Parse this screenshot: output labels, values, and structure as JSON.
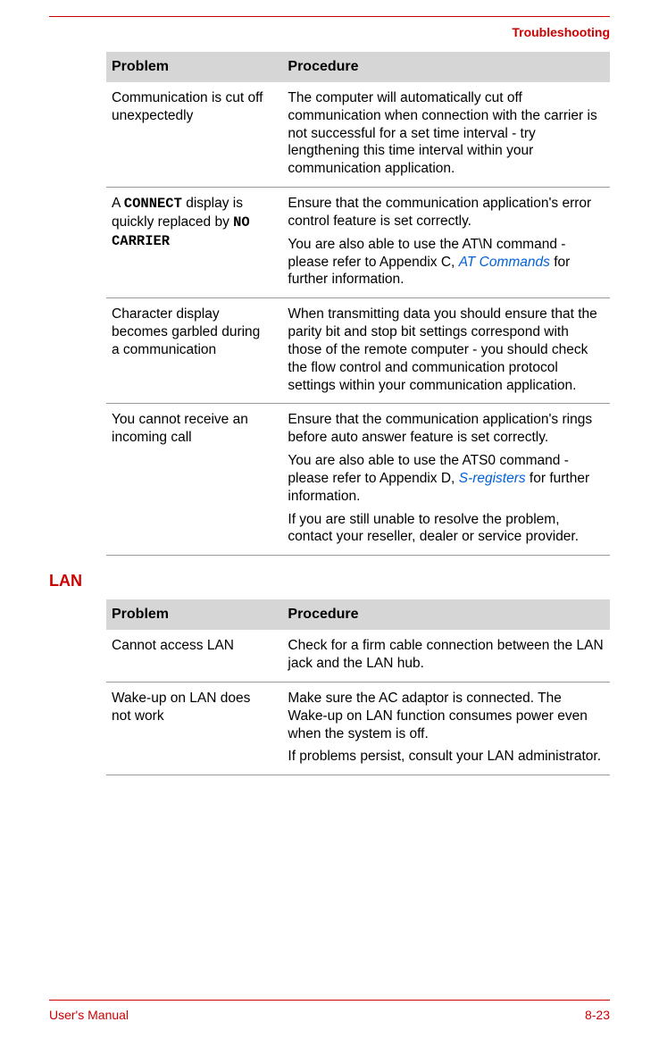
{
  "header": {
    "section": "Troubleshooting"
  },
  "table1": {
    "head": {
      "problem": "Problem",
      "procedure": "Procedure"
    },
    "rows": [
      {
        "problem_parts": [
          {
            "text": "Communication is cut off unexpectedly"
          }
        ],
        "procedure_parts": [
          {
            "paras": [
              [
                {
                  "text": "The computer will automatically cut off communication when connection with the carrier is not successful for a set time interval - try lengthening this time interval within your communication application."
                }
              ]
            ]
          }
        ]
      },
      {
        "problem_parts": [
          {
            "text": "A "
          },
          {
            "text": "CONNECT",
            "mono": true
          },
          {
            "text": " display is quickly replaced by "
          },
          {
            "text": "NO CARRIER",
            "mono": true
          }
        ],
        "procedure_parts": [
          {
            "paras": [
              [
                {
                  "text": "Ensure that the communication application's error control feature is set correctly."
                }
              ],
              [
                {
                  "text": "You are also able to use the AT\\N command - please refer to Appendix C, "
                },
                {
                  "text": "AT Commands",
                  "link": true
                },
                {
                  "text": " for further information."
                }
              ]
            ]
          }
        ]
      },
      {
        "problem_parts": [
          {
            "text": "Character display becomes garbled during a communication"
          }
        ],
        "procedure_parts": [
          {
            "paras": [
              [
                {
                  "text": "When transmitting data you should ensure that the parity bit and stop bit settings correspond with those of the remote computer - you should check the flow control and communication protocol settings within your communication application."
                }
              ]
            ]
          }
        ]
      },
      {
        "problem_parts": [
          {
            "text": "You cannot receive an incoming call"
          }
        ],
        "procedure_parts": [
          {
            "paras": [
              [
                {
                  "text": "Ensure that the communication application's rings before auto answer feature is set correctly."
                }
              ],
              [
                {
                  "text": "You are also able to use the ATS0 command - please refer to Appendix D, "
                },
                {
                  "text": "S-registers",
                  "link": true
                },
                {
                  "text": " for further information."
                }
              ],
              [
                {
                  "text": "If you are still unable to resolve the problem, contact your reseller, dealer or service provider."
                }
              ]
            ]
          }
        ]
      }
    ]
  },
  "section_lan": "LAN",
  "table2": {
    "head": {
      "problem": "Problem",
      "procedure": "Procedure"
    },
    "rows": [
      {
        "problem_parts": [
          {
            "text": "Cannot access LAN"
          }
        ],
        "procedure_parts": [
          {
            "paras": [
              [
                {
                  "text": "Check for a firm cable connection between the LAN jack and the LAN hub."
                }
              ]
            ]
          }
        ]
      },
      {
        "problem_parts": [
          {
            "text": "Wake-up on LAN does not work"
          }
        ],
        "procedure_parts": [
          {
            "paras": [
              [
                {
                  "text": "Make sure the AC adaptor is connected. The Wake-up on LAN function consumes power even when the system is off."
                }
              ],
              [
                {
                  "text": "If problems persist, consult your LAN administrator."
                }
              ]
            ]
          }
        ]
      }
    ]
  },
  "footer": {
    "left": "User's Manual",
    "right": "8-23"
  }
}
